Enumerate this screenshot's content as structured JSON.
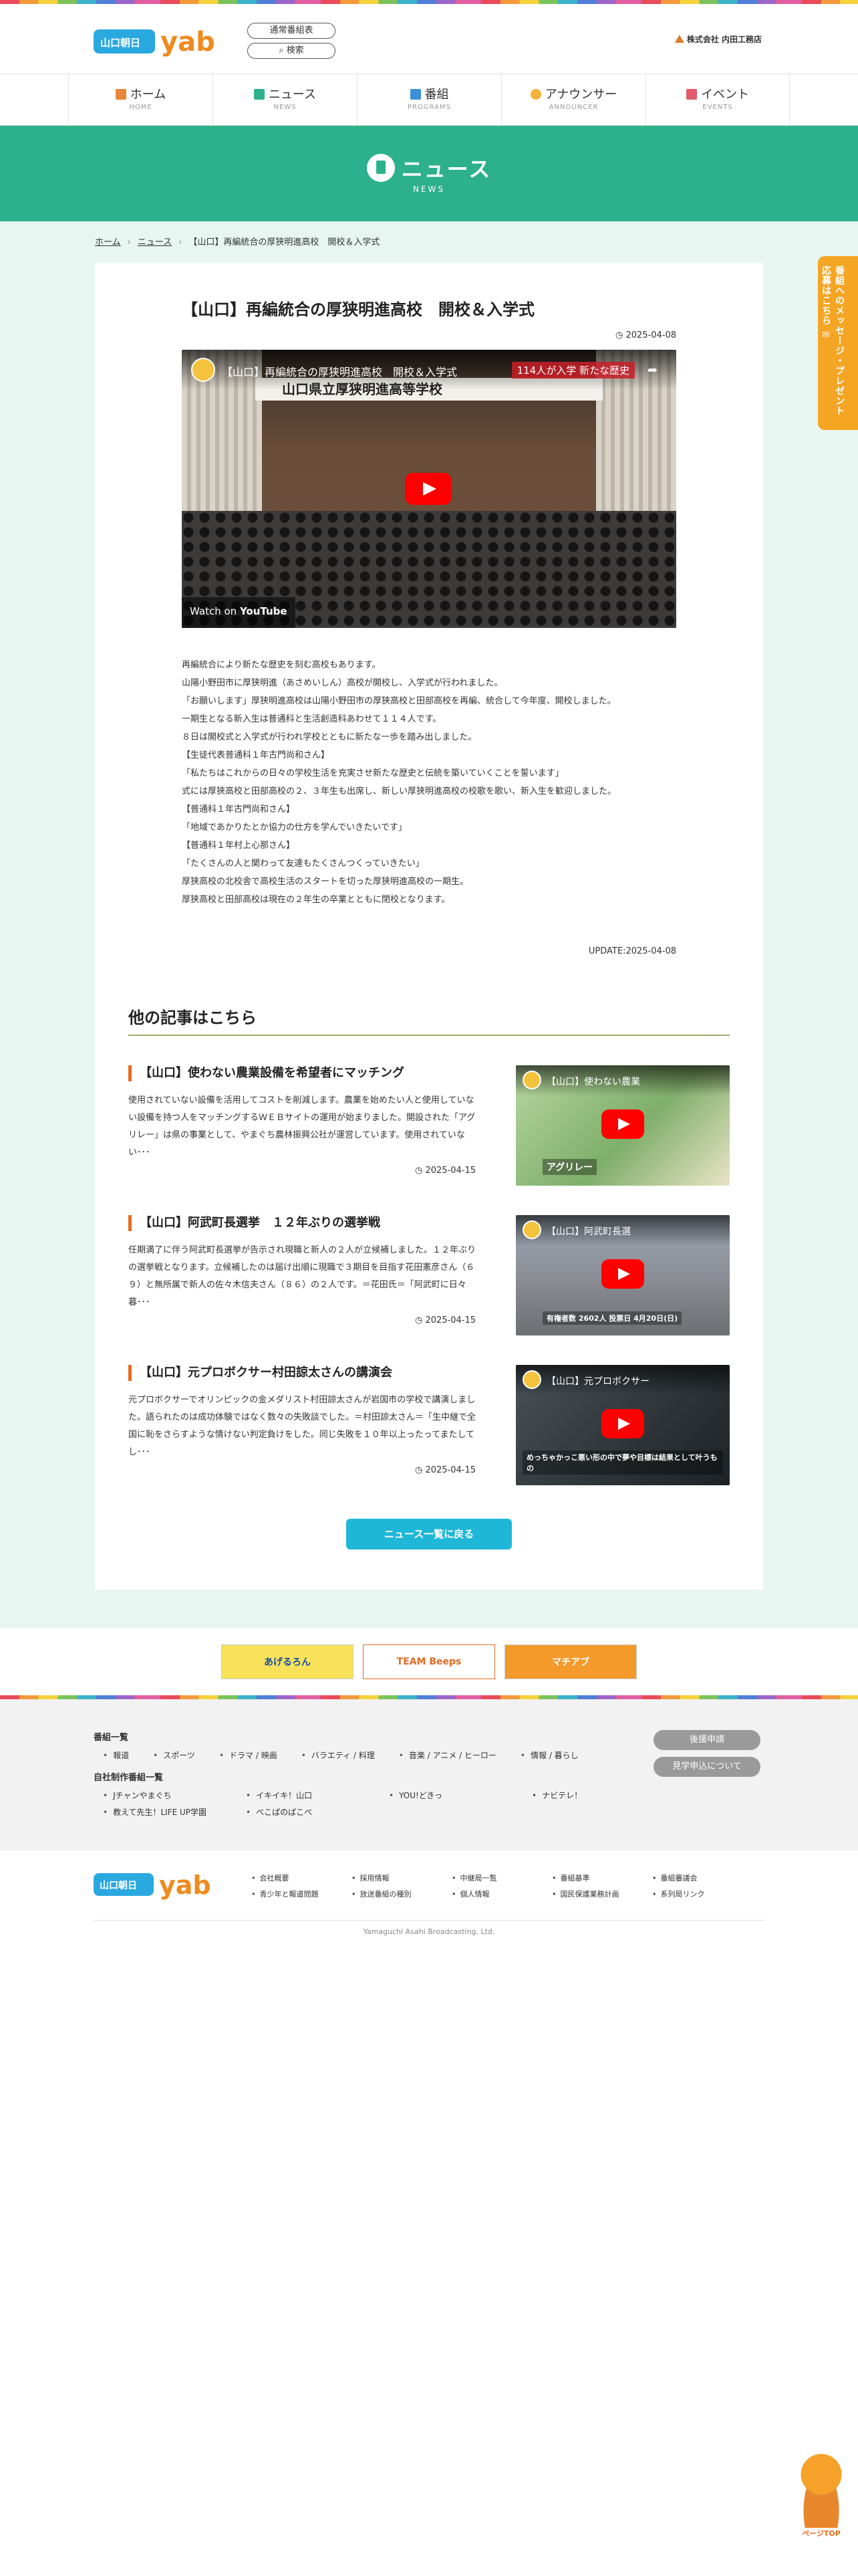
{
  "header": {
    "logo_text": "yab",
    "links": [
      "通常番組表",
      "検索"
    ],
    "sponsor": "株式会社 内田工務店"
  },
  "nav": [
    {
      "ja": "ホーム",
      "en": "HOME",
      "color": "#e8863a"
    },
    {
      "ja": "ニュース",
      "en": "NEWS",
      "color": "#2db18c"
    },
    {
      "ja": "番組",
      "en": "PROGRAMS",
      "color": "#3b8fd6"
    },
    {
      "ja": "アナウンサー",
      "en": "ANNOUNCER",
      "color": "#f3b23a"
    },
    {
      "ja": "イベント",
      "en": "EVENTS",
      "color": "#e25b6b"
    }
  ],
  "hero": {
    "title": "ニュース",
    "subtitle": "NEWS"
  },
  "breadcrumb": [
    "ホーム",
    "ニュース",
    "【山口】再編統合の厚狭明進高校　開校＆入学式"
  ],
  "article": {
    "title": "【山口】再編統合の厚狭明進高校　開校＆入学式",
    "date": "2025-04-08",
    "video_title": "【山口】再編統合の厚狭明進高校　開校＆入学式",
    "video_tag": "114人が入学 新たな歴史",
    "video_banner": "山口県立厚狭明進高等学校",
    "watch_on": "Watch on",
    "youtube": "YouTube",
    "paragraphs": [
      "再編統合により新たな歴史を刻む高校もあります。",
      "山陽小野田市に厚狭明進（あさめいしん）高校が開校し、入学式が行われました。",
      "「お願いします」厚狭明進高校は山陽小野田市の厚狭高校と田部高校を再編、統合して今年度、開校しました。",
      "一期生となる新入生は普通科と生活創造科あわせて１１４人です。",
      "８日は開校式と入学式が行われ学校とともに新たな一歩を踏み出しました。",
      "【生徒代表普通科１年古門尚和さん】",
      "「私たちはこれからの日々の学校生活を充実させ新たな歴史と伝統を築いていくことを誓います」",
      "式には厚狭高校と田部高校の２、３年生も出席し、新しい厚狭明進高校の校歌を歌い、新入生を歓迎しました。",
      "【普通科１年古門尚和さん】",
      "「地域であかりたとか協力の仕方を学んでいきたいです」",
      "【普通科１年村上心那さん】",
      "「たくさんの人と関わって友達もたくさんつくっていきたい」",
      "厚狭高校の北校舎で高校生活のスタートを切った厚狭明進高校の一期生。",
      "厚狭高校と田部高校は現在の２年生の卒業とともに閉校となります。"
    ],
    "update": "UPDATE:2025-04-08"
  },
  "others": {
    "heading": "他の記事はこちら",
    "items": [
      {
        "title": "【山口】使わない農業設備を希望者にマッチング",
        "excerpt": "使用されていない設備を活用してコストを削減します。農業を始めたい人と使用していない設備を持つ人をマッチングするＷＥＢサイトの運用が始まりました。開設された「アグリレー」は県の事業として、やまぐち農林振興公社が運営しています。使用されていない･･･",
        "date": "2025-04-15",
        "thumb_title": "【山口】使わない農業",
        "thumb_caption": "アグリレー",
        "thumb_color": "#7fae6a"
      },
      {
        "title": "【山口】阿武町長選挙　１２年ぶりの選挙戦",
        "excerpt": "任期満了に伴う阿武町長選挙が告示され現職と新人の２人が立候補しました。１２年ぶりの選挙戦となります。立候補したのは届け出順に現職で３期目を目指す花田憲彦さん（６９）と無所属で新人の佐々木信夫さん（８６）の２人です。＝花田氏＝「阿武町に日々暮･･･",
        "date": "2025-04-15",
        "thumb_title": "【山口】阿武町長選",
        "thumb_caption": "有権者数 2602人 投票日 4月20日(日)",
        "thumb_color": "#8c8f96"
      },
      {
        "title": "【山口】元プロボクサー村田諒太さんの講演会",
        "excerpt": "元プロボクサーでオリンピックの金メダリスト村田諒太さんが岩国市の学校で講演しました。語られたのは成功体験ではなく数々の失敗談でした。＝村田諒太さん＝「生中継で全国に恥をさらすような情けない判定負けをした。同じ失敗を１０年以上ったってまたしてし･･･",
        "date": "2025-04-15",
        "thumb_title": "【山口】元プロボクサー",
        "thumb_caption": "めっちゃかっこ悪い形の中で夢や目標は結果として叶うもの",
        "thumb_color": "#2d3438"
      }
    ],
    "back_button": "ニュース一覧に戻る"
  },
  "banners": [
    "あげるろん",
    "TEAM Beeps",
    "マチアブ"
  ],
  "footer": {
    "program_heading": "番組一覧",
    "program_links": [
      "報道",
      "スポーツ",
      "ドラマ / 映画",
      "バラエティ / 料理",
      "音楽 / アニメ / ヒーロー",
      "情報 / 暮らし"
    ],
    "own_heading": "自社制作番組一覧",
    "own_links": [
      "Jチャンやまぐち",
      "イキイキ！山口",
      "YOU!どきっ",
      "ナビテレ！",
      "教えて先生！LIFE UP学園",
      "べこぱのぱこべ"
    ],
    "buttons": [
      "後援申請",
      "見学申込について"
    ],
    "col1": [
      "会社概要",
      "青少年と報道問題"
    ],
    "col2": [
      "採用情報",
      "放送番組の種別"
    ],
    "col3": [
      "中継局一覧",
      "個人情報"
    ],
    "col4": [
      "番組基準",
      "国民保護業務計画"
    ],
    "col5": [
      "番組審議会",
      "系列局リンク"
    ],
    "copyright": "Yamaguchi Asahi Broadcasting, Ltd."
  },
  "side_tab": "番組へのメッセージ・プレゼント応募はこちら",
  "pagetop": "ページTOP"
}
